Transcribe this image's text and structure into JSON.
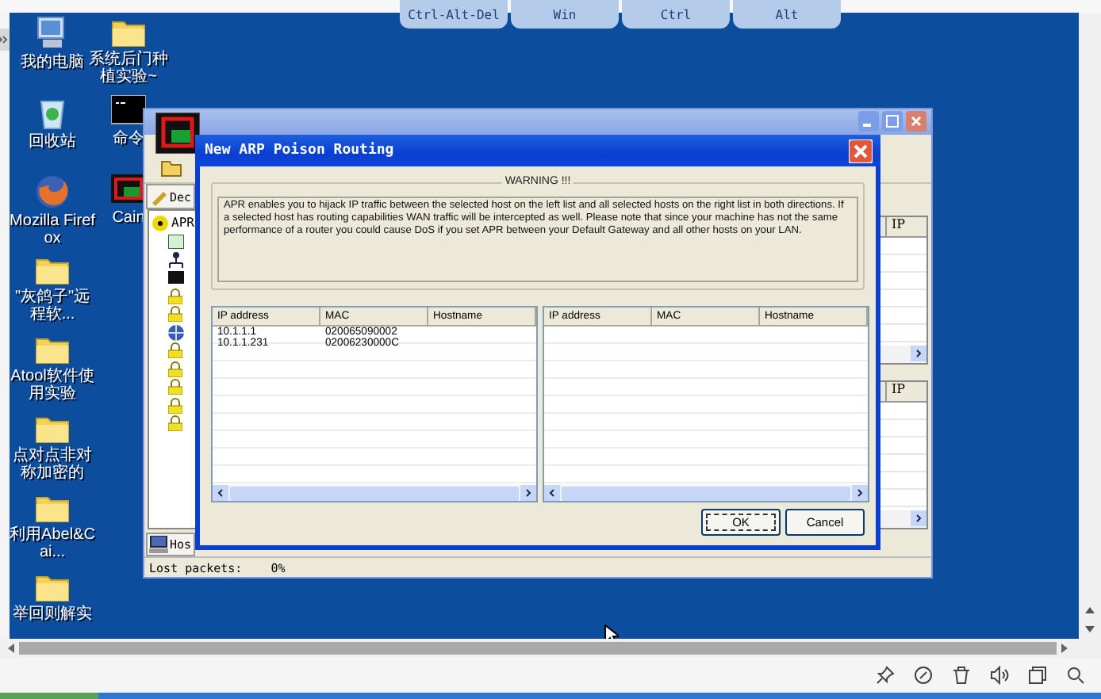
{
  "remote_keys": [
    {
      "label": "Ctrl-Alt-Del"
    },
    {
      "label": "Win"
    },
    {
      "label": "Ctrl"
    },
    {
      "label": "Alt"
    }
  ],
  "desktop_columns": [
    [
      {
        "label": "我的电脑",
        "kind": "computer"
      },
      {
        "label": "回收站",
        "kind": "recycle"
      },
      {
        "label": "Mozilla Firefox",
        "kind": "firefox"
      },
      {
        "label": "\"灰鸽子\"远程软...",
        "kind": "folder"
      },
      {
        "label": "Atool软件使用实验",
        "kind": "folder"
      },
      {
        "label": "点对点非对称加密的",
        "kind": "folder"
      },
      {
        "label": "利用Abel&Cai...",
        "kind": "folder"
      },
      {
        "label": "举回则解实",
        "kind": "folder"
      }
    ],
    [
      {
        "label": "系统后门种植实验~",
        "kind": "folder"
      },
      {
        "label": "命令",
        "kind": "cmd"
      },
      {
        "label": "Cain",
        "kind": "cain"
      }
    ]
  ],
  "cain_window": {
    "top_tab": "Dec",
    "tree": [
      {
        "label": "APR"
      }
    ],
    "list_headers": [
      "IP",
      "IP"
    ],
    "bottom_tab": "Hos",
    "status": {
      "label": "Lost packets:",
      "value": "0%"
    }
  },
  "dialog": {
    "title": "New ARP Poison Routing",
    "warning_title": "WARNING !!!",
    "warning_text": "APR enables you to hijack IP traffic between the selected host on the left list and all selected hosts on the right list in both directions. If a selected host has routing capabilities WAN traffic will be intercepted as well. Please note that since your machine has not the same performance of a router you could cause DoS if you set APR between your Default Gateway and all other hosts on your LAN.",
    "lists": [
      {
        "columns": [
          "IP address",
          "MAC",
          "Hostname"
        ],
        "rows": [
          [
            "10.1.1.1",
            "020065090002",
            ""
          ],
          [
            "10.1.1.231",
            "02006230000C",
            ""
          ]
        ]
      },
      {
        "columns": [
          "IP address",
          "MAC",
          "Hostname"
        ]
      }
    ],
    "buttons": [
      {
        "label": "OK",
        "kind": "default"
      },
      {
        "label": "Cancel",
        "kind": "normal"
      }
    ]
  }
}
